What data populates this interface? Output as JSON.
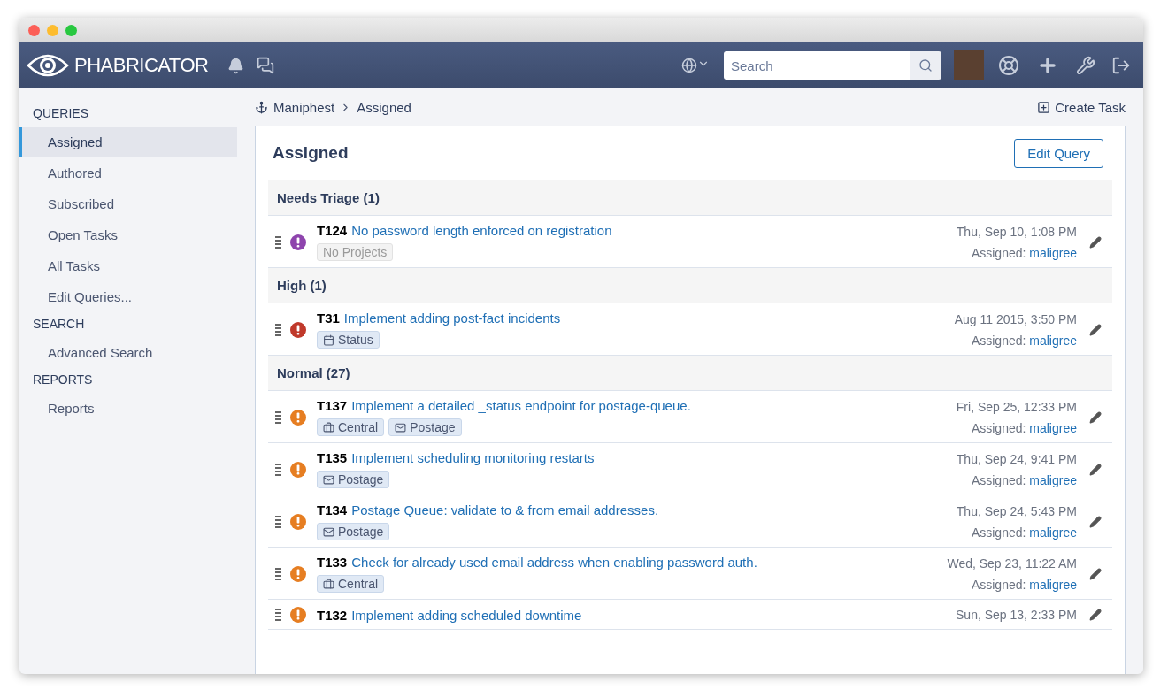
{
  "header": {
    "logo_text": "PHABRICATOR",
    "search": {
      "placeholder": "Search"
    }
  },
  "sidebar": {
    "sections": [
      {
        "title": "QUERIES",
        "items": [
          {
            "label": "Assigned",
            "selected": true
          },
          {
            "label": "Authored",
            "selected": false
          },
          {
            "label": "Subscribed",
            "selected": false
          },
          {
            "label": "Open Tasks",
            "selected": false
          },
          {
            "label": "All Tasks",
            "selected": false
          },
          {
            "label": "Edit Queries...",
            "selected": false
          }
        ]
      },
      {
        "title": "SEARCH",
        "items": [
          {
            "label": "Advanced Search",
            "selected": false
          }
        ]
      },
      {
        "title": "REPORTS",
        "items": [
          {
            "label": "Reports",
            "selected": false
          }
        ]
      }
    ]
  },
  "breadcrumbs": [
    "Maniphest",
    "Assigned"
  ],
  "create_task": "Create Task",
  "panel": {
    "title": "Assigned",
    "edit_button": "Edit Query",
    "groups": [
      {
        "title": "Needs Triage (1)",
        "tasks": [
          {
            "id": "T124",
            "title": "No password length enforced on registration",
            "color": "#8e44ad",
            "tags": [
              {
                "kind": "empty",
                "label": "No Projects"
              }
            ],
            "date": "Thu, Sep 10, 1:08 PM",
            "assigned_label": "Assigned:",
            "assignee": "maligree"
          }
        ]
      },
      {
        "title": "High (1)",
        "tasks": [
          {
            "id": "T31",
            "title": "Implement adding post-fact incidents",
            "color": "#c0392b",
            "tags": [
              {
                "kind": "calendar",
                "label": "Status"
              }
            ],
            "date": "Aug 11 2015, 3:50 PM",
            "assigned_label": "Assigned:",
            "assignee": "maligree"
          }
        ]
      },
      {
        "title": "Normal (27)",
        "tasks": [
          {
            "id": "T137",
            "title": "Implement a detailed _status endpoint for postage-queue.",
            "color": "#e67e22",
            "tags": [
              {
                "kind": "briefcase",
                "label": "Central"
              },
              {
                "kind": "envelope",
                "label": "Postage"
              }
            ],
            "date": "Fri, Sep 25, 12:33 PM",
            "assigned_label": "Assigned:",
            "assignee": "maligree"
          },
          {
            "id": "T135",
            "title": "Implement scheduling monitoring restarts",
            "color": "#e67e22",
            "tags": [
              {
                "kind": "envelope",
                "label": "Postage"
              }
            ],
            "date": "Thu, Sep 24, 9:41 PM",
            "assigned_label": "Assigned:",
            "assignee": "maligree"
          },
          {
            "id": "T134",
            "title": "Postage Queue: validate to & from email addresses.",
            "color": "#e67e22",
            "tags": [
              {
                "kind": "envelope",
                "label": "Postage"
              }
            ],
            "date": "Thu, Sep 24, 5:43 PM",
            "assigned_label": "Assigned:",
            "assignee": "maligree"
          },
          {
            "id": "T133",
            "title": "Check for already used email address when enabling password auth.",
            "color": "#e67e22",
            "tags": [
              {
                "kind": "briefcase",
                "label": "Central"
              }
            ],
            "date": "Wed, Sep 23, 11:22 AM",
            "assigned_label": "Assigned:",
            "assignee": "maligree"
          },
          {
            "id": "T132",
            "title": "Implement adding scheduled downtime",
            "color": "#e67e22",
            "date": "Sun, Sep 13, 2:33 PM"
          }
        ]
      }
    ]
  }
}
